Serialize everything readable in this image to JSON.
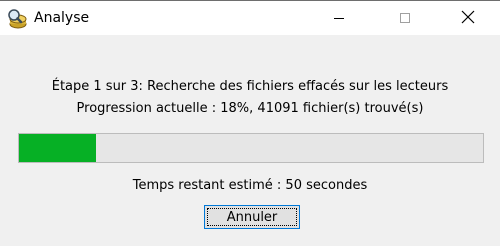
{
  "window": {
    "title": "Analyse",
    "app_icon": "analysis-app-icon",
    "controls": {
      "minimize_icon": "minimize-icon",
      "maximize_icon": "maximize-icon",
      "close_icon": "close-icon"
    }
  },
  "status": {
    "step_text": "Étape 1 sur 3: Recherche des fichiers effacés sur les lecteurs",
    "progress_text": "Progression actuelle : 18%, 41091 fichier(s) trouvé(s)",
    "time_remaining_text": "Temps restant estimé : 50 secondes"
  },
  "progress": {
    "value": 0.165,
    "fill_color": "#06b025",
    "track_color": "#e6e6e6"
  },
  "buttons": {
    "cancel_label": "Annuler"
  }
}
